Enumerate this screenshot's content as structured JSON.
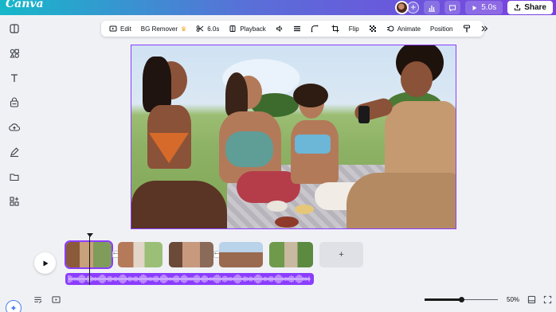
{
  "header": {
    "logo": "Canva",
    "play_label": "5.0s",
    "share_label": "Share"
  },
  "sidebar": {
    "items": [
      "layout-icon",
      "elements-icon",
      "text-icon",
      "brand-icon",
      "uploads-icon",
      "draw-icon",
      "projects-icon",
      "apps-icon"
    ],
    "magic_icon": "sparkle-icon"
  },
  "toolbar": {
    "edit_label": "Edit",
    "bg_remover_label": "BG Remover",
    "duration_label": "6.0s",
    "playback_label": "Playback",
    "flip_label": "Flip",
    "animate_label": "Animate",
    "position_label": "Position"
  },
  "timeline": {
    "add_clip_label": "+",
    "clips": 5,
    "transition_glyph": "⟷"
  },
  "footer": {
    "zoom_label": "50%",
    "zoom_level": 0.5
  },
  "colors": {
    "accent": "#8b3dff",
    "header_start": "#16b8c9",
    "header_end": "#7b3fe0"
  }
}
